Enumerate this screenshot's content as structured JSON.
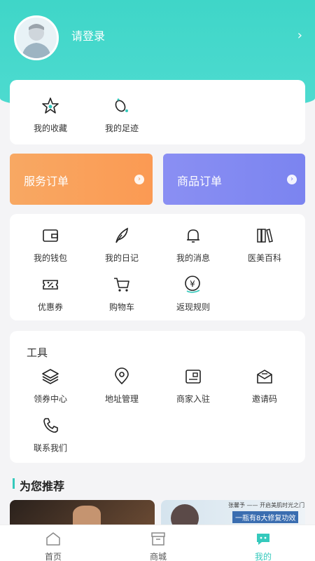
{
  "header": {
    "login_text": "请登录",
    "chevron": "›"
  },
  "quick": {
    "favorites": "我的收藏",
    "footprints": "我的足迹"
  },
  "orders": {
    "service": "服务订单",
    "goods": "商品订单",
    "service_color": "#fb9a53",
    "goods_color": "#7b84f0"
  },
  "menu": {
    "wallet": "我的钱包",
    "diary": "我的日记",
    "messages": "我的消息",
    "encyclopedia": "医美百科",
    "coupons": "优惠券",
    "cart": "购物车",
    "cashback": "返现规则"
  },
  "tools": {
    "title": "工具",
    "coupon_center": "领券中心",
    "address": "地址管理",
    "merchant": "商家入驻",
    "invite": "邀请码",
    "contact": "联系我们"
  },
  "recommend": {
    "title": "为您推荐",
    "banner_name": "张馨予",
    "banner_line": "开启美肌时光之门",
    "banner_text": "一瓶有8大修复功效"
  },
  "tabbar": {
    "home": "首页",
    "mall": "商城",
    "mine": "我的"
  },
  "colors": {
    "accent": "#35c9bc"
  }
}
